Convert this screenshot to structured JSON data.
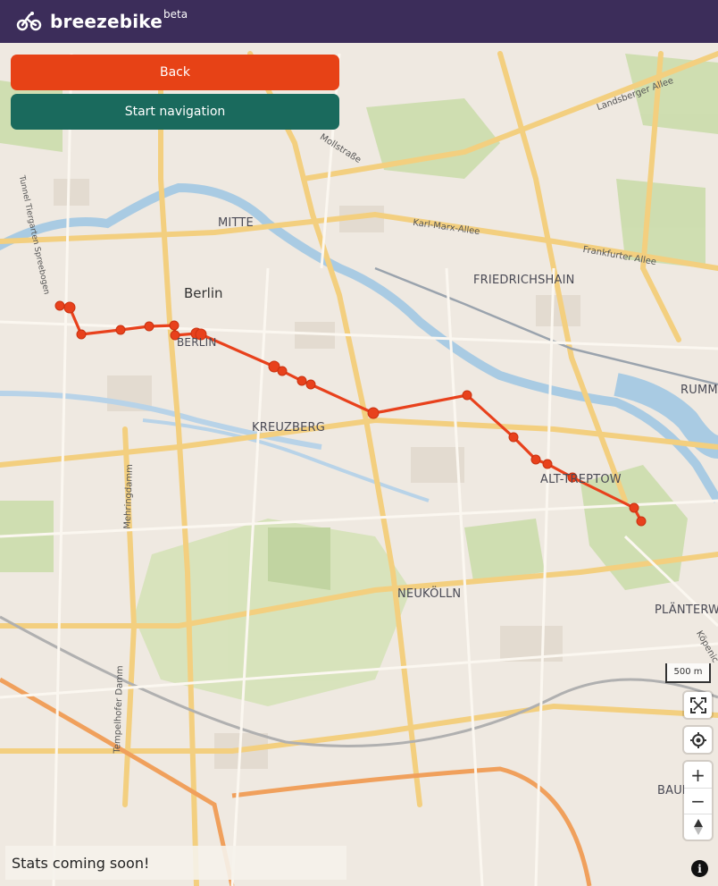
{
  "header": {
    "brand": "breezebike",
    "beta": "beta",
    "logo_icon": "bicycle-icon"
  },
  "actions": {
    "back_label": "Back",
    "start_navigation_label": "Start navigation"
  },
  "map": {
    "labels": {
      "mitte": "MITTE",
      "berlin_city": "Berlin",
      "berlin_small": "BERLIN",
      "friedrichshain": "FRIEDRICHSHAIN",
      "kreuzberg": "KREUZBERG",
      "alt_treptow": "ALT-TREPTOW",
      "neukoelln": "NEUKÖLLN",
      "plaenterwald": "PLÄNTERWA",
      "rummelsburg": "RUMMI",
      "baumschulenweg": "BAUM",
      "landsberger_allee": "Landsberger Allee",
      "mollstrasse": "Mollstraße",
      "karl_marx_allee": "Karl-Marx-Allee",
      "frankfurter_allee": "Frankfurter Allee",
      "tunnel_tiergarten": "Tunnel Tiergarten Spreebogen",
      "mehringdamm": "Mehringdamm",
      "tempelhofer_damm": "Tempelhofer Damm",
      "koepenicker": "Köpenic"
    },
    "scale_label": "500 m",
    "route_color": "#e8411c",
    "controls": {
      "fullscreen_icon": "fullscreen-icon",
      "locate_icon": "locate-icon",
      "zoom_in": "+",
      "zoom_out": "−",
      "compass_icon": "compass-icon"
    }
  },
  "stats": {
    "text": "Stats coming soon!"
  },
  "info": {
    "label": "i"
  }
}
